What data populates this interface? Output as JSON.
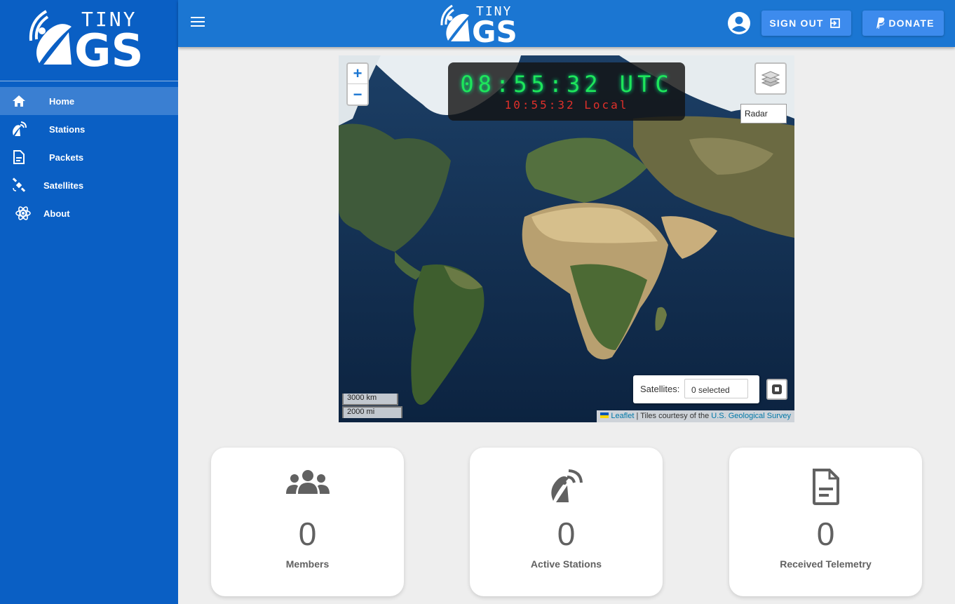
{
  "brand": {
    "logo_top": "TINY",
    "logo_bottom": "GS"
  },
  "sidebar": {
    "items": [
      {
        "label": "Home",
        "icon": "home-icon",
        "active": true
      },
      {
        "label": "Stations",
        "icon": "satellite-dish-icon"
      },
      {
        "label": "Packets",
        "icon": "document-icon"
      },
      {
        "label": "Satellites",
        "icon": "satellite-icon"
      },
      {
        "label": "About",
        "icon": "atom-icon"
      }
    ]
  },
  "topbar": {
    "signout_label": "SIGN OUT",
    "donate_label": "DONATE"
  },
  "map": {
    "utc_time": "08:55:32 UTC",
    "local_time": "10:55:32 Local",
    "zoom_in": "+",
    "zoom_out": "−",
    "layer_option": "Radar",
    "satellites_label": "Satellites:",
    "satellites_value": "0 selected",
    "scale_km": "3000 km",
    "scale_mi": "2000 mi",
    "attribution_leaflet": "Leaflet",
    "attribution_text": " | Tiles courtesy of the ",
    "attribution_usgs": "U.S. Geological Survey"
  },
  "stats": [
    {
      "value": "0",
      "label": "Members",
      "icon": "users-icon"
    },
    {
      "value": "0",
      "label": "Active Stations",
      "icon": "satellite-dish-icon"
    },
    {
      "value": "0",
      "label": "Received Telemetry",
      "icon": "document-icon"
    }
  ],
  "colors": {
    "sidebar": "#0a5fc4",
    "topbar": "#1b76d2",
    "button": "#3d8bed",
    "clock_utc": "#1ee65a",
    "clock_local": "#e0302a"
  }
}
